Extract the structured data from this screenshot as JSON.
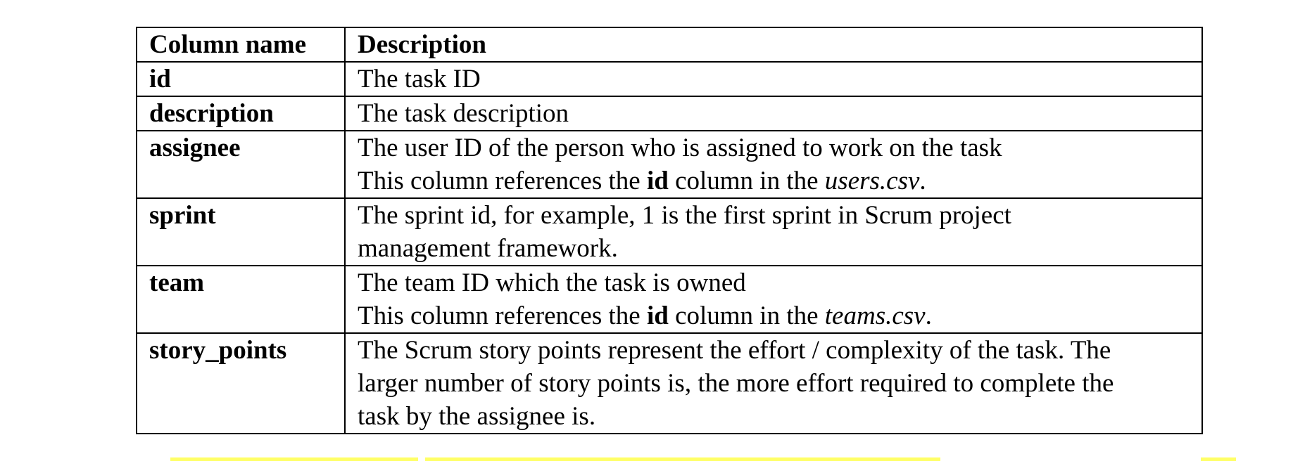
{
  "table": {
    "headers": [
      "Column name",
      "Description"
    ],
    "rows": [
      {
        "name": "id",
        "lines": [
          [
            {
              "text": "The task ID"
            }
          ]
        ]
      },
      {
        "name": "description",
        "lines": [
          [
            {
              "text": "The task description"
            }
          ]
        ]
      },
      {
        "name": "assignee",
        "lines": [
          [
            {
              "text": "The user ID of the person who is assigned to work on the task"
            }
          ],
          [
            {
              "text": "This column references the "
            },
            {
              "text": "id",
              "bold": true
            },
            {
              "text": " column in the "
            },
            {
              "text": "users.csv",
              "italic": true
            },
            {
              "text": "."
            }
          ]
        ]
      },
      {
        "name": "sprint",
        "lines": [
          [
            {
              "text": "The sprint id, for example, 1 is the first sprint in Scrum project"
            }
          ],
          [
            {
              "text": "management framework."
            }
          ]
        ]
      },
      {
        "name": "team",
        "lines": [
          [
            {
              "text": "The team ID which the task is owned"
            }
          ],
          [
            {
              "text": "This column references the "
            },
            {
              "text": "id",
              "bold": true
            },
            {
              "text": " column in the "
            },
            {
              "text": "teams.csv",
              "italic": true
            },
            {
              "text": "."
            }
          ]
        ]
      },
      {
        "name": "story_points",
        "lines": [
          [
            {
              "text": "The Scrum story points represent the effort / complexity of the task. The"
            }
          ],
          [
            {
              "text": "larger number of story points is, the more effort required to complete the"
            }
          ],
          [
            {
              "text": "task by the assignee is."
            }
          ]
        ]
      }
    ]
  },
  "colors": {
    "text": "#000000",
    "border": "#000000",
    "highlight": "#ffff66"
  }
}
